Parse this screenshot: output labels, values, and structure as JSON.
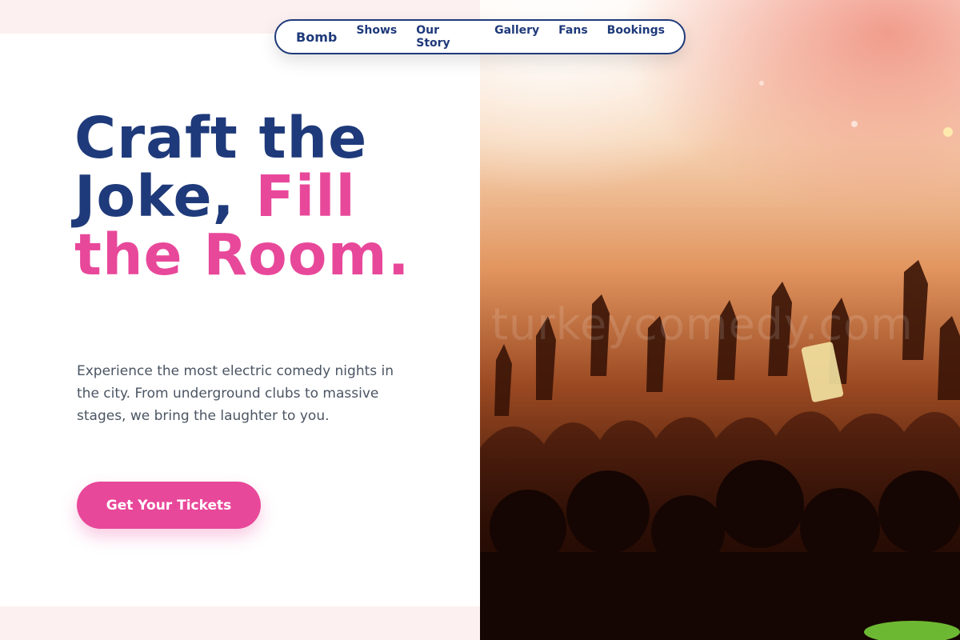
{
  "nav": {
    "brand": "Bomb",
    "items": [
      "Shows",
      "Our Story",
      "Gallery",
      "Fans",
      "Bookings"
    ]
  },
  "hero": {
    "title_part1": "Craft the Joke, ",
    "title_accent": "Fill the Room.",
    "description": "Experience the most electric comedy nights in the city. From underground clubs to massive stages, we bring the laughter to you.",
    "cta_label": "Get Your Tickets"
  },
  "image": {
    "subject": "concert crowd with raised hands",
    "watermark": "turkeycomedy.com"
  },
  "colors": {
    "primary": "#1f3a7a",
    "accent": "#e8489a",
    "text_muted": "#4b5563",
    "page_background": "#fdf0f1"
  }
}
